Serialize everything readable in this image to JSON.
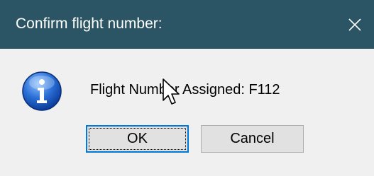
{
  "window": {
    "title": "Confirm flight number:",
    "close_icon": "close-icon",
    "colors": {
      "titlebar": "#2b5564",
      "title_text": "#ffffff",
      "client_bg": "#f0f0f0",
      "accent": "#0078d7"
    }
  },
  "content": {
    "icon": "info-icon",
    "message": "Flight Number Assigned: F112"
  },
  "buttons": {
    "ok_label": "OK",
    "cancel_label": "Cancel",
    "default": "OK"
  },
  "cursor": {
    "icon": "mouse-pointer-icon"
  }
}
